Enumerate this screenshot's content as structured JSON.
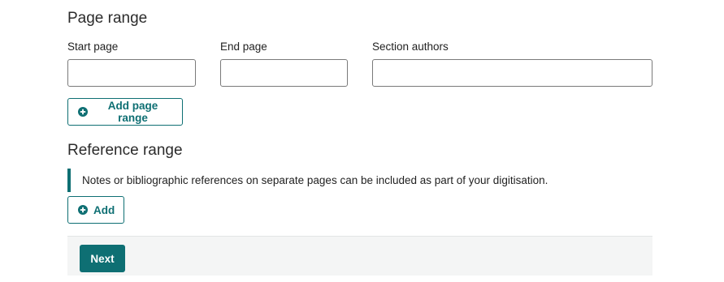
{
  "page_range": {
    "heading": "Page range",
    "start_page": {
      "label": "Start page",
      "value": ""
    },
    "end_page": {
      "label": "End page",
      "value": ""
    },
    "section_authors": {
      "label": "Section authors",
      "value": ""
    },
    "add_button": {
      "label": "Add page range",
      "icon": "plus-circle-icon"
    }
  },
  "reference_range": {
    "heading": "Reference range",
    "notice": "Notes or bibliographic references on separate pages can be included as part of your digitisation.",
    "add_button": {
      "label": "Add",
      "icon": "plus-circle-icon"
    }
  },
  "footer": {
    "next_label": "Next"
  },
  "colors": {
    "accent": "#0e6f73",
    "footer_bg": "#f4f5f5",
    "input_border": "#7a7a7a"
  }
}
